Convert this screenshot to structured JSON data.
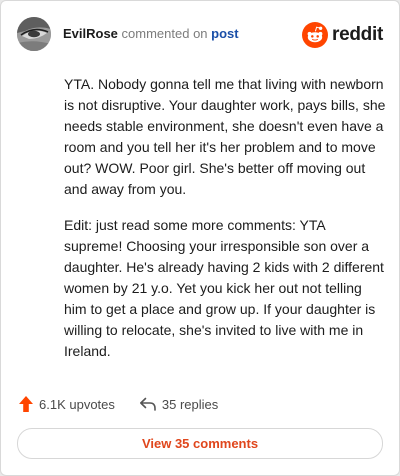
{
  "comment": {
    "username": "EvilRose",
    "action_text": "commented on",
    "target_text": "post",
    "paragraphs": [
      "YTA. Nobody gonna tell me that living with newborn is not disruptive. Your daughter work, pays bills, she needs stable environment, she doesn't even have a room and you tell her it's her problem and to move out? WOW. Poor girl. She's better off moving out and away from you.",
      "Edit: just read some more comments: YTA supreme! Choosing your irresponsible son over a daughter. He's already having 2 kids with 2 different women by 21 y.o. Yet you kick her out not telling him to get a place and grow up. If your daughter is willing to relocate, she's invited to live with me in Ireland."
    ]
  },
  "brand": {
    "name": "reddit",
    "icon": "reddit-alien-icon",
    "color": "#ff4500"
  },
  "actions": {
    "upvotes": "6.1K upvotes",
    "replies": "35 replies",
    "upvote_icon": "upvote-arrow-icon",
    "reply_icon": "reply-arrow-icon",
    "upvote_color": "#ff4500"
  },
  "view_all": {
    "label": "View 35 comments",
    "color": "#e0461c"
  }
}
